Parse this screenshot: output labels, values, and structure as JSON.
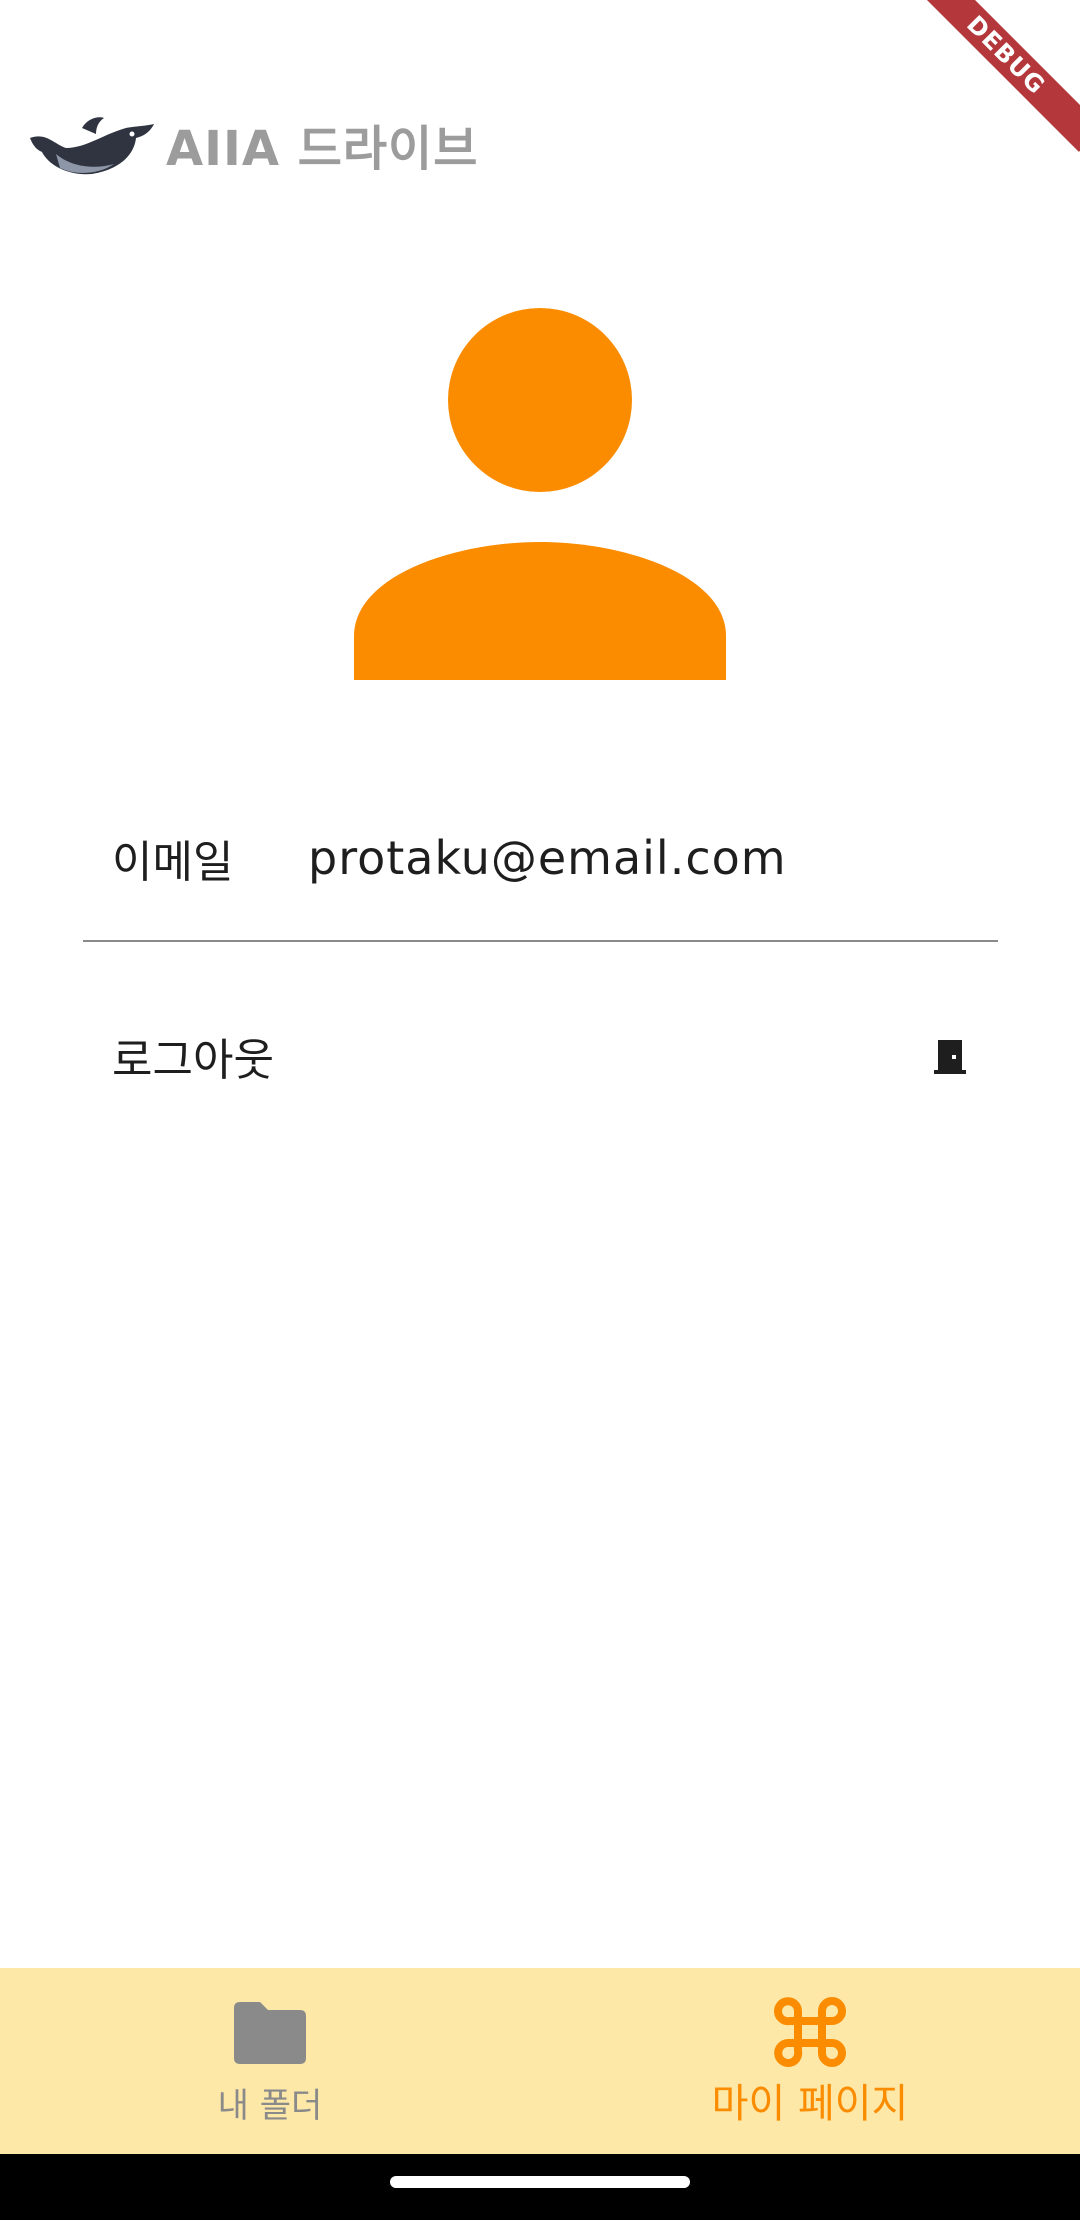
{
  "debug_banner": "DEBUG",
  "header": {
    "logo_icon": "dolphin-logo-icon",
    "title": "AIIA 드라이브"
  },
  "profile": {
    "avatar_icon": "person-icon",
    "avatar_color": "#fb8c00",
    "email_label": "이메일",
    "email_value": "protaku@email.com"
  },
  "actions": {
    "logout_label": "로그아웃",
    "logout_icon": "door-icon"
  },
  "bottom_nav": {
    "background": "#fde8a8",
    "items": [
      {
        "label": "내 폴더",
        "icon": "folder-icon",
        "active": false
      },
      {
        "label": "마이 페이지",
        "icon": "command-icon",
        "active": true
      }
    ]
  },
  "colors": {
    "accent": "#fb8c00",
    "inactive": "#8a8a8a",
    "title_gray": "#9c9c9c"
  }
}
